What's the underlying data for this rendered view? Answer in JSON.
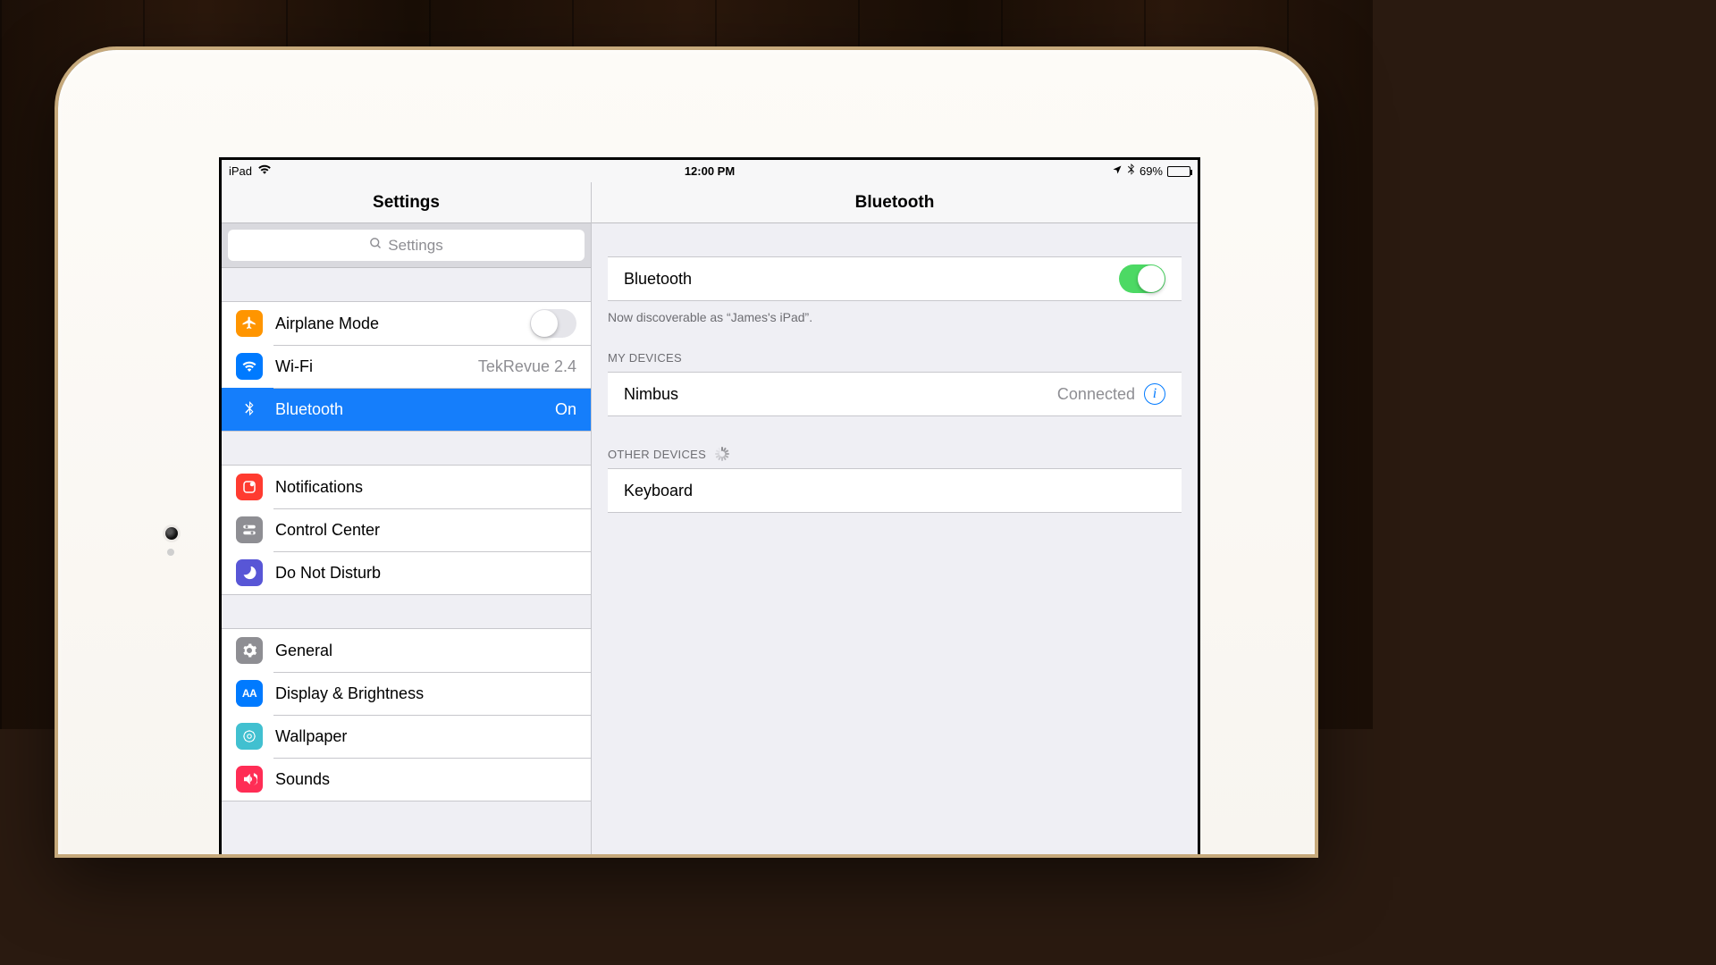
{
  "statusbar": {
    "device": "iPad",
    "time": "12:00 PM",
    "battery_pct": "69%",
    "battery_fill": 69
  },
  "sidebar": {
    "title": "Settings",
    "search_placeholder": "Settings",
    "items": {
      "airplane": {
        "label": "Airplane Mode"
      },
      "wifi": {
        "label": "Wi-Fi",
        "value": "TekRevue 2.4"
      },
      "bluetooth": {
        "label": "Bluetooth",
        "value": "On"
      },
      "notifications": {
        "label": "Notifications"
      },
      "control": {
        "label": "Control Center"
      },
      "dnd": {
        "label": "Do Not Disturb"
      },
      "general": {
        "label": "General"
      },
      "display": {
        "label": "Display & Brightness"
      },
      "wallpaper": {
        "label": "Wallpaper"
      },
      "sounds": {
        "label": "Sounds"
      }
    }
  },
  "detail": {
    "title": "Bluetooth",
    "toggle_label": "Bluetooth",
    "toggle_on": true,
    "discoverable_text": "Now discoverable as “James's iPad”.",
    "my_devices_header": "MY DEVICES",
    "my_devices": [
      {
        "name": "Nimbus",
        "status": "Connected"
      }
    ],
    "other_devices_header": "OTHER DEVICES",
    "other_devices": [
      {
        "name": "Keyboard"
      }
    ]
  }
}
